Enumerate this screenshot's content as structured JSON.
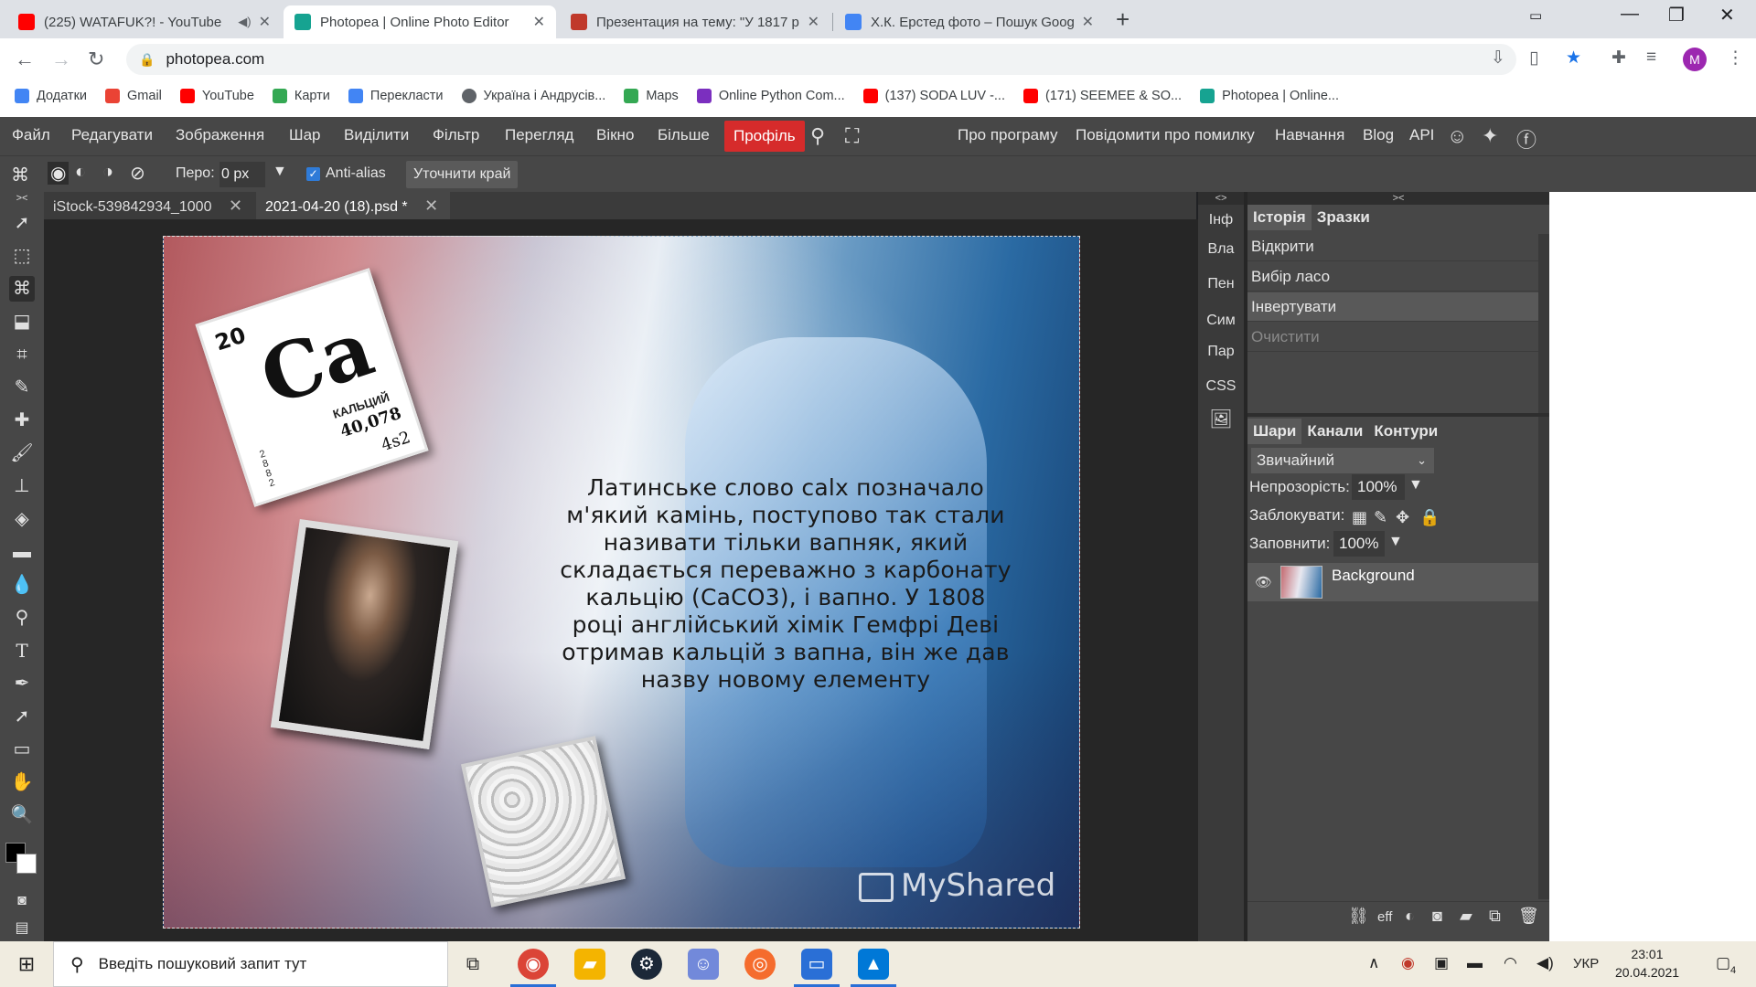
{
  "browser": {
    "tabs": [
      {
        "title": "(225) WATAFUK?! - YouTube",
        "active": false
      },
      {
        "title": "Photopea | Online Photo Editor",
        "active": true
      },
      {
        "title": "Презентация на тему: \"У 1817 р",
        "active": false
      },
      {
        "title": "Х.К. Ерстед фото – Пошук Googl",
        "active": false
      }
    ],
    "url": "photopea.com",
    "avatar_letter": "M",
    "bookmarks": [
      {
        "label": "Додатки",
        "color": "#4285f4"
      },
      {
        "label": "Gmail",
        "color": "#ea4335"
      },
      {
        "label": "YouTube",
        "color": "#ff0000"
      },
      {
        "label": "Карти",
        "color": "#34a853"
      },
      {
        "label": "Перекласти",
        "color": "#4285f4"
      },
      {
        "label": "Україна і Андрусів...",
        "color": "#5f6368"
      },
      {
        "label": "Maps",
        "color": "#34a853"
      },
      {
        "label": "Online Python Com...",
        "color": "#7b2fbf"
      },
      {
        "label": "(137) SODA LUV -...",
        "color": "#ff0000"
      },
      {
        "label": "(171) SEEMEE & SO...",
        "color": "#ff0000"
      },
      {
        "label": "Photopea | Online...",
        "color": "#16a391"
      }
    ]
  },
  "menubar": {
    "items": [
      "Файл",
      "Редагувати",
      "Зображення",
      "Шар",
      "Виділити",
      "Фільтр",
      "Перегляд",
      "Вікно",
      "Більше"
    ],
    "profile": "Профіль",
    "right_items": [
      "Про програму",
      "Повідомити про помилку",
      "Навчання",
      "Blog",
      "API"
    ]
  },
  "options": {
    "pero_label": "Перо:",
    "pero_value": "0 px",
    "antialias_label": "Anti-alias",
    "refine_label": "Уточнити край"
  },
  "doc_tabs": [
    {
      "title": "iStock-539842934_1000",
      "active": false
    },
    {
      "title": "2021-04-20 (18).psd *",
      "active": true
    }
  ],
  "canvas_text": {
    "ca_number": "20",
    "ca_symbol": "Ca",
    "ca_name": "КАЛЬЦИЙ",
    "ca_mass": "40,078",
    "ca_shell": "4s2",
    "paragraph": "Латинське слово calx позначало м'який камінь, поступово так стали називати тільки вапняк, який складається переважно з карбонату кальцію (CaCO3), і вапно. У 1808 році англійський хімік Гемфрі Деві отримав кальцій з вапна, він же дав назву новому елементу",
    "watermark": "MyShared"
  },
  "mini_panel": {
    "tabs": [
      "Інф",
      "Вла",
      "Пен",
      "Сим",
      "Пар",
      "CSS"
    ]
  },
  "history_panel": {
    "tabs": [
      "Історія",
      "Зразки"
    ],
    "items": [
      "Відкрити",
      "Вибір ласо",
      "Інвертувати",
      "Очистити"
    ]
  },
  "layers_panel": {
    "tabs": [
      "Шари",
      "Канали",
      "Контури"
    ],
    "blend_mode": "Звичайний",
    "opacity_label": "Непрозорість:",
    "opacity_value": "100%",
    "lock_label": "Заблокувати:",
    "fill_label": "Заповнити:",
    "fill_value": "100%",
    "layer_name": "Background",
    "footer_eff": "eff"
  },
  "taskbar": {
    "search_placeholder": "Введіть пошуковий запит тут",
    "language": "УКР",
    "time": "23:01",
    "date": "20.04.2021",
    "notifications": "4"
  }
}
